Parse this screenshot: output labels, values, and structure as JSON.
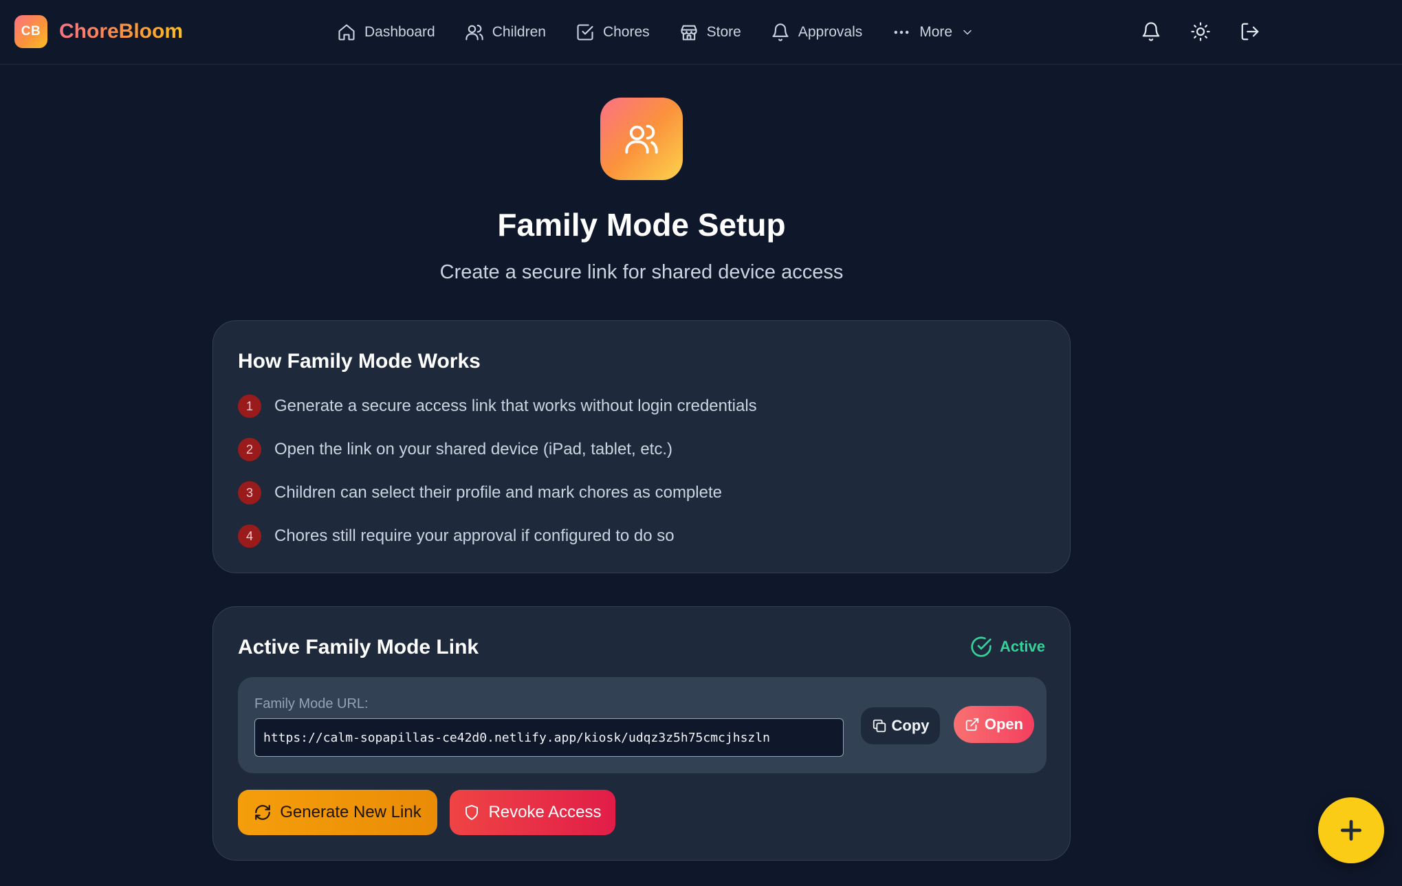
{
  "brand": {
    "badge": "CB",
    "name": "ChoreBloom"
  },
  "nav": {
    "items": [
      {
        "label": "Dashboard",
        "icon": "home-icon"
      },
      {
        "label": "Children",
        "icon": "users-icon"
      },
      {
        "label": "Chores",
        "icon": "checkbox-icon"
      },
      {
        "label": "Store",
        "icon": "store-icon"
      },
      {
        "label": "Approvals",
        "icon": "bell-icon"
      },
      {
        "label": "More",
        "icon": "dots-icon"
      }
    ],
    "right_icons": [
      "notifications-bell-icon",
      "theme-sun-icon",
      "logout-icon"
    ]
  },
  "hero": {
    "icon": "users-icon",
    "title": "Family Mode Setup",
    "subtitle": "Create a secure link for shared device access"
  },
  "how_it_works": {
    "title": "How Family Mode Works",
    "steps": [
      {
        "num": "1",
        "text": "Generate a secure access link that works without login credentials"
      },
      {
        "num": "2",
        "text": "Open the link on your shared device (iPad, tablet, etc.)"
      },
      {
        "num": "3",
        "text": "Children can select their profile and mark chores as complete"
      },
      {
        "num": "4",
        "text": "Chores still require your approval if configured to do so"
      }
    ]
  },
  "active_link": {
    "title": "Active Family Mode Link",
    "status": "Active",
    "url_label": "Family Mode URL:",
    "url": "https://calm-sopapillas-ce42d0.netlify.app/kiosk/udqz3z5h75cmcjhszln",
    "copy_label": "Copy",
    "open_label": "Open",
    "generate_label": "Generate New Link",
    "revoke_label": "Revoke Access"
  },
  "colors": {
    "background": "#0f172a",
    "card": "#1e293b",
    "accent_orange": "#f59e0b",
    "accent_red": "#ef4444",
    "status_green": "#34d399",
    "fab_yellow": "#facc15"
  }
}
